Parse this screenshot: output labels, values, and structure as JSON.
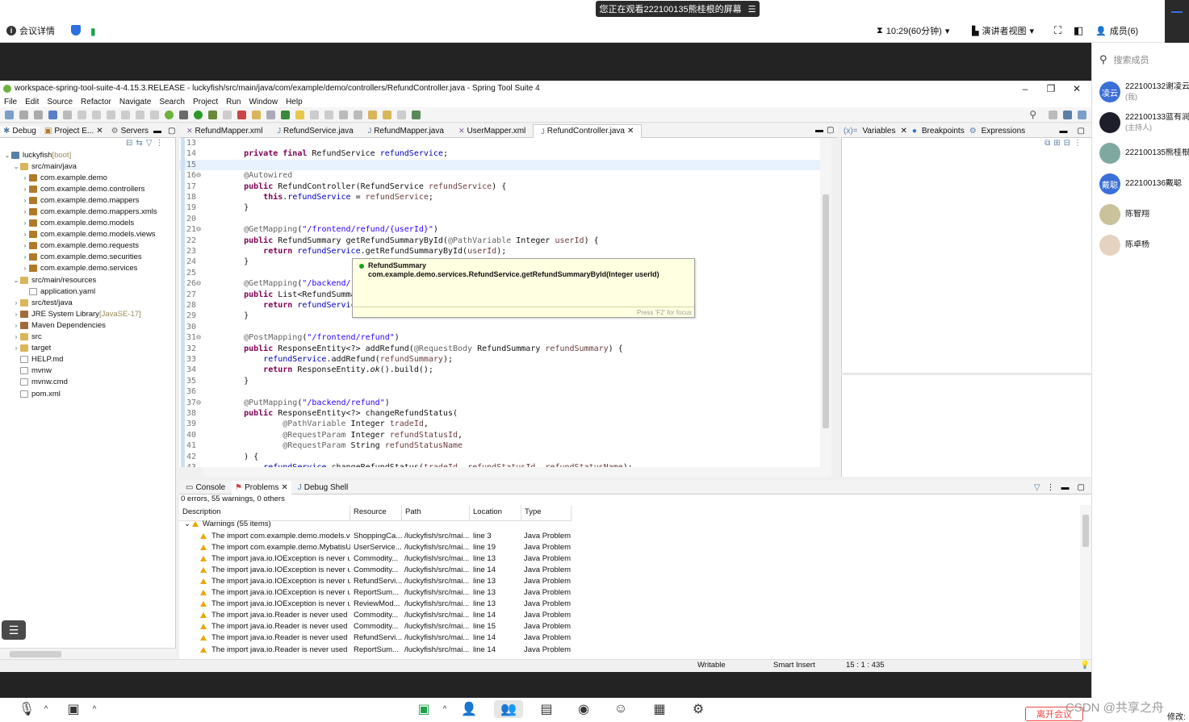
{
  "meeting": {
    "viewing_banner": "您正在观看222100135熊桂根的屏幕",
    "details": "会议详情",
    "timer": "10:29(60分钟)",
    "presenter_view": "演讲者视图",
    "members": "成员(6)",
    "search_placeholder": "搜索成员",
    "member_list": [
      {
        "avatar_text": "凌云",
        "avatar_color": "#3b6fd8",
        "name": "222100132谢凌云",
        "sub": "(我)"
      },
      {
        "avatar_text": "",
        "avatar_color": "#1e1e2a",
        "name": "222100133蓝有润",
        "sub": "(主持人)"
      },
      {
        "avatar_text": "",
        "avatar_color": "#7fa9a0",
        "name": "222100135熊桂根",
        "sub": ""
      },
      {
        "avatar_text": "戴聪",
        "avatar_color": "#3b6fd8",
        "name": "222100136戴聪",
        "sub": ""
      },
      {
        "avatar_text": "",
        "avatar_color": "#c9c29a",
        "name": "陈智翔",
        "sub": ""
      },
      {
        "avatar_text": "",
        "avatar_color": "#e6d2c0",
        "name": "陈卓杨",
        "sub": ""
      }
    ],
    "leave_button": "离开会议",
    "edit_label": "修改:",
    "watermark": "CSDN @共享之舟"
  },
  "ide": {
    "title": "workspace-spring-tool-suite-4-4.15.3.RELEASE - luckyfish/src/main/java/com/example/demo/controllers/RefundController.java - Spring Tool Suite 4",
    "menu": [
      "File",
      "Edit",
      "Source",
      "Refactor",
      "Navigate",
      "Search",
      "Project",
      "Run",
      "Window",
      "Help"
    ],
    "left_tabs": [
      "Debug",
      "Project E...",
      "Servers"
    ],
    "tree": [
      {
        "indent": 0,
        "twisty": "v",
        "icon": "proj",
        "label": "luckyfish",
        "suffix": " [boot]"
      },
      {
        "indent": 1,
        "twisty": "v",
        "icon": "fold",
        "label": "src/main/java",
        "suffix": ""
      },
      {
        "indent": 2,
        "twisty": ">",
        "icon": "pkg",
        "label": "com.example.demo",
        "suffix": ""
      },
      {
        "indent": 2,
        "twisty": ">",
        "icon": "pkg",
        "label": "com.example.demo.controllers",
        "suffix": ""
      },
      {
        "indent": 2,
        "twisty": ">",
        "icon": "pkg",
        "label": "com.example.demo.mappers",
        "suffix": ""
      },
      {
        "indent": 2,
        "twisty": ">",
        "icon": "pkg",
        "label": "com.example.demo.mappers.xmls",
        "suffix": ""
      },
      {
        "indent": 2,
        "twisty": ">",
        "icon": "pkg",
        "label": "com.example.demo.models",
        "suffix": ""
      },
      {
        "indent": 2,
        "twisty": ">",
        "icon": "pkg",
        "label": "com.example.demo.models.views",
        "suffix": ""
      },
      {
        "indent": 2,
        "twisty": ">",
        "icon": "pkg",
        "label": "com.example.demo.requests",
        "suffix": ""
      },
      {
        "indent": 2,
        "twisty": ">",
        "icon": "pkg",
        "label": "com.example.demo.securities",
        "suffix": ""
      },
      {
        "indent": 2,
        "twisty": ">",
        "icon": "pkg",
        "label": "com.example.demo.services",
        "suffix": ""
      },
      {
        "indent": 1,
        "twisty": "v",
        "icon": "fold",
        "label": "src/main/resources",
        "suffix": ""
      },
      {
        "indent": 2,
        "twisty": "",
        "icon": "file",
        "label": "application.yaml",
        "suffix": ""
      },
      {
        "indent": 1,
        "twisty": ">",
        "icon": "fold",
        "label": "src/test/java",
        "suffix": ""
      },
      {
        "indent": 1,
        "twisty": ">",
        "icon": "jar",
        "label": "JRE System Library",
        "suffix": " [JavaSE-17]"
      },
      {
        "indent": 1,
        "twisty": ">",
        "icon": "jar",
        "label": "Maven Dependencies",
        "suffix": ""
      },
      {
        "indent": 1,
        "twisty": ">",
        "icon": "fold",
        "label": "src",
        "suffix": ""
      },
      {
        "indent": 1,
        "twisty": ">",
        "icon": "fold",
        "label": "target",
        "suffix": ""
      },
      {
        "indent": 1,
        "twisty": "",
        "icon": "file",
        "label": "HELP.md",
        "suffix": ""
      },
      {
        "indent": 1,
        "twisty": "",
        "icon": "file",
        "label": "mvnw",
        "suffix": ""
      },
      {
        "indent": 1,
        "twisty": "",
        "icon": "file",
        "label": "mvnw.cmd",
        "suffix": ""
      },
      {
        "indent": 1,
        "twisty": "",
        "icon": "file",
        "label": "pom.xml",
        "suffix": ""
      }
    ],
    "editor_tabs": [
      "RefundMapper.xml",
      "RefundService.java",
      "RefundMapper.java",
      "UserMapper.xml",
      "RefundController.java"
    ],
    "code_lines": [
      {
        "n": "13",
        "html": ""
      },
      {
        "n": "14",
        "html": "    <span class=\"kw\">private final</span> RefundService <span class=\"fld\">refundService</span>;"
      },
      {
        "n": "15",
        "html": "",
        "hl": true
      },
      {
        "n": "16⊖",
        "html": "    <span class=\"an\">@Autowired</span>"
      },
      {
        "n": "17",
        "html": "    <span class=\"kw\">public</span> RefundController(RefundService <span class=\"par\">refundService</span>) {"
      },
      {
        "n": "18",
        "html": "        <span class=\"kw\">this</span>.<span class=\"fld\">refundService</span> = <span class=\"par\">refundService</span>;"
      },
      {
        "n": "19",
        "html": "    }"
      },
      {
        "n": "20",
        "html": ""
      },
      {
        "n": "21⊖",
        "html": "    <span class=\"an\">@GetMapping</span>(<span class=\"str\">\"/frontend/refund/{userId}\"</span>)"
      },
      {
        "n": "22",
        "html": "    <span class=\"kw\">public</span> RefundSummary getRefundSummaryById(<span class=\"an\">@PathVariable</span> Integer <span class=\"par\">userId</span>) {"
      },
      {
        "n": "23",
        "html": "        <span class=\"kw\">return</span> <span class=\"fld\">refundService</span>.getRefundSummaryById(<span class=\"par\">userId</span>);"
      },
      {
        "n": "24",
        "html": "    }"
      },
      {
        "n": "25",
        "html": ""
      },
      {
        "n": "26⊖",
        "html": "    <span class=\"an\">@GetMapping</span>(<span class=\"str\">\"/backend/ref</span>"
      },
      {
        "n": "27",
        "html": "    <span class=\"kw\">public</span> List&lt;RefundSummary"
      },
      {
        "n": "28",
        "html": "        <span class=\"kw\">return</span> <span class=\"fld\">refundService</span>."
      },
      {
        "n": "29",
        "html": "    }"
      },
      {
        "n": "30",
        "html": ""
      },
      {
        "n": "31⊖",
        "html": "    <span class=\"an\">@PostMapping</span>(<span class=\"str\">\"/frontend/refund\"</span>)"
      },
      {
        "n": "32",
        "html": "    <span class=\"kw\">public</span> ResponseEntity&lt;?&gt; addRefund(<span class=\"an\">@RequestBody</span> RefundSummary <span class=\"par\">refundSummary</span>) {"
      },
      {
        "n": "33",
        "html": "        <span class=\"fld\">refundService</span>.addRefund(<span class=\"par\">refundSummary</span>);"
      },
      {
        "n": "34",
        "html": "        <span class=\"kw\">return</span> ResponseEntity.<i>ok</i>().build();"
      },
      {
        "n": "35",
        "html": "    }"
      },
      {
        "n": "36",
        "html": ""
      },
      {
        "n": "37⊖",
        "html": "    <span class=\"an\">@PutMapping</span>(<span class=\"str\">\"/backend/refund\"</span>)"
      },
      {
        "n": "38",
        "html": "    <span class=\"kw\">public</span> ResponseEntity&lt;?&gt; changeRefundStatus("
      },
      {
        "n": "39",
        "html": "            <span class=\"an\">@PathVariable</span> Integer <span class=\"par\">tradeId</span>,"
      },
      {
        "n": "40",
        "html": "            <span class=\"an\">@RequestParam</span> Integer <span class=\"par\">refundStatusId</span>,"
      },
      {
        "n": "41",
        "html": "            <span class=\"an\">@RequestParam</span> String <span class=\"par\">refundStatusName</span>"
      },
      {
        "n": "42",
        "html": "    ) {"
      },
      {
        "n": "43",
        "html": "        <span class=\"fld\">refundService</span>.changeRefundStatus(<span class=\"par\">tradeId</span>, <span class=\"par\">refundStatusId</span>, <span class=\"par\">refundStatusName</span>);"
      }
    ],
    "hover_tip": {
      "text": "RefundSummary com.example.demo.services.RefundService.getRefundSummaryById(Integer userId)",
      "focus_hint": "Press 'F2' for focus"
    },
    "right_tabs": [
      "Variables",
      "Breakpoints",
      "Expressions"
    ],
    "bottom_tabs": [
      "Console",
      "Problems",
      "Debug Shell"
    ],
    "problems_summary": "0 errors, 55 warnings, 0 others",
    "problems_headers": [
      "Description",
      "Resource",
      "Path",
      "Location",
      "Type"
    ],
    "warnings_group": "Warnings (55 items)",
    "problems_rows": [
      {
        "desc": "The import com.example.demo.models.vie",
        "res": "ShoppingCa...",
        "path": "/luckyfish/src/mai...",
        "loc": "line 3",
        "type": "Java Problem"
      },
      {
        "desc": "The import com.example.demo.MybatisUt",
        "res": "UserService...",
        "path": "/luckyfish/src/mai...",
        "loc": "line 19",
        "type": "Java Problem"
      },
      {
        "desc": "The import java.io.IOException is never us",
        "res": "Commodity...",
        "path": "/luckyfish/src/mai...",
        "loc": "line 13",
        "type": "Java Problem"
      },
      {
        "desc": "The import java.io.IOException is never us",
        "res": "Commodity...",
        "path": "/luckyfish/src/mai...",
        "loc": "line 14",
        "type": "Java Problem"
      },
      {
        "desc": "The import java.io.IOException is never us",
        "res": "RefundServi...",
        "path": "/luckyfish/src/mai...",
        "loc": "line 13",
        "type": "Java Problem"
      },
      {
        "desc": "The import java.io.IOException is never us",
        "res": "ReportSum...",
        "path": "/luckyfish/src/mai...",
        "loc": "line 13",
        "type": "Java Problem"
      },
      {
        "desc": "The import java.io.IOException is never us",
        "res": "ReviewMod...",
        "path": "/luckyfish/src/mai...",
        "loc": "line 13",
        "type": "Java Problem"
      },
      {
        "desc": "The import java.io.Reader is never used",
        "res": "Commodity...",
        "path": "/luckyfish/src/mai...",
        "loc": "line 14",
        "type": "Java Problem"
      },
      {
        "desc": "The import java.io.Reader is never used",
        "res": "Commodity...",
        "path": "/luckyfish/src/mai...",
        "loc": "line 15",
        "type": "Java Problem"
      },
      {
        "desc": "The import java.io.Reader is never used",
        "res": "RefundServi...",
        "path": "/luckyfish/src/mai...",
        "loc": "line 14",
        "type": "Java Problem"
      },
      {
        "desc": "The import java.io.Reader is never used",
        "res": "ReportSum...",
        "path": "/luckyfish/src/mai...",
        "loc": "line 14",
        "type": "Java Problem"
      }
    ],
    "status": {
      "writable": "Writable",
      "insert_mode": "Smart Insert",
      "position": "15 : 1 : 435"
    }
  }
}
